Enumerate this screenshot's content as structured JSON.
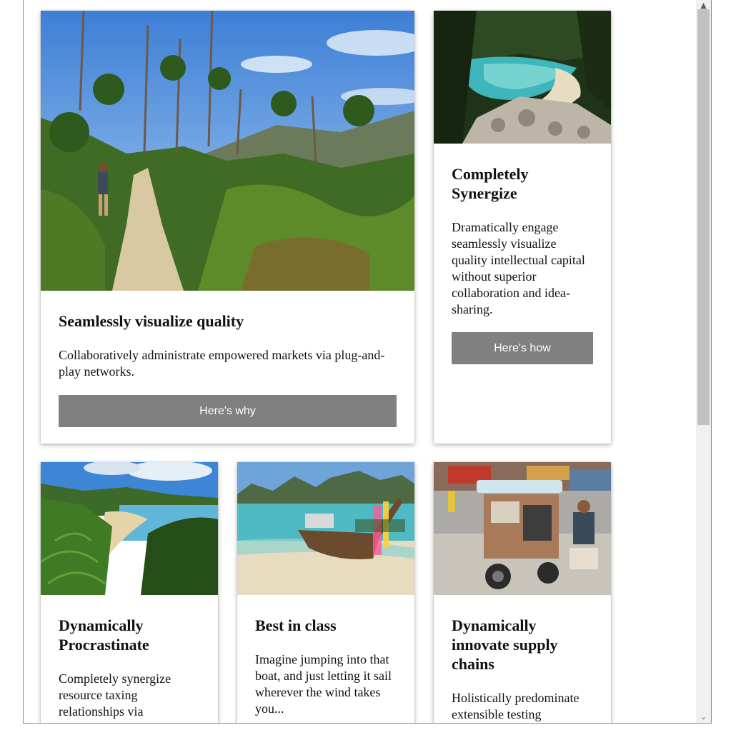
{
  "cards": [
    {
      "title": "Seamlessly visualize quality",
      "text": "Collaboratively administrate empowered markets via plug-and-play networks.",
      "button": "Here's why",
      "image": "forest-trail-hiker"
    },
    {
      "title": "Completely Synergize",
      "text": "Dramatically engage seamlessly visualize quality intellectual capital without superior collaboration and idea-sharing.",
      "button": "Here's how",
      "image": "turquoise-cove"
    },
    {
      "title": "Dynamically Procrastinate",
      "text": "Completely synergize resource taxing relationships via",
      "image": "beach-with-ferns"
    },
    {
      "title": "Best in class",
      "text": "Imagine jumping into that boat, and just letting it sail wherever the wind takes you...",
      "image": "longtail-boat"
    },
    {
      "title": "Dynamically innovate supply chains",
      "text": "Holistically predominate extensible testing",
      "image": "street-tuk-tuk"
    }
  ],
  "scrollbar": {
    "up_icon": "chevron-up-icon",
    "down_icon": "chevron-down-icon"
  }
}
